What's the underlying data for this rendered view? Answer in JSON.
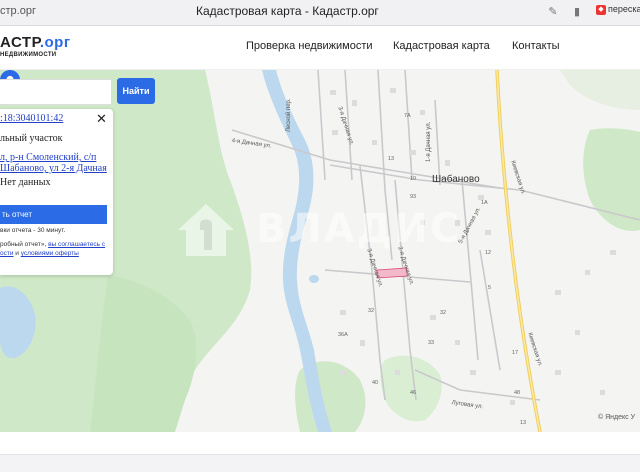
{
  "browser": {
    "url": "стр.орг",
    "title": "Кадастровая карта - Кадастр.орг",
    "tab_chip": "пересказ"
  },
  "site": {
    "logo_main": "АСТР",
    "logo_accent": ".орг",
    "logo_sub": "НЕДВИЖИМОСТИ",
    "nav": [
      "Проверка недвижимости",
      "Кадастровая карта",
      "Контакты"
    ]
  },
  "search": {
    "value": "",
    "button": "Найти"
  },
  "panel": {
    "cadastral_number": ":18:3040101:42",
    "object_type": "льный участок",
    "address": "л, р-н Смоленский, с/п Шабаново, ул 2-я Дачная",
    "value_status": "Нет данных",
    "order_button": "ть отчет",
    "delivery_time": "вки отчета - 30 минут.",
    "agree_prefix": "робный отчет», ",
    "agree_link1": "вы соглашаетесь с",
    "agree_mid": "ости",
    "agree_and": " и ",
    "agree_link2": "условиями оферты"
  },
  "map": {
    "village": "Шабаново",
    "watermark": "ВЛАДИС",
    "copyright": "© Яндекс У",
    "streets": {
      "lesnoy": "Лесной пер.",
      "dachnaya3": "3-я Дачная ул.",
      "dachnaya4": "4-я Дачная ул.",
      "dachnaya1": "1-я Дачная ул.",
      "dachnaya2": "2-я Дачная ул.",
      "dachnaya3b": "3-я Дачная ул.",
      "dachnaya5": "5-я Дачная ул.",
      "kievskaya1": "Киевская ул.",
      "kievskaya2": "Киевская ул.",
      "lugovaya": "Луговая ул."
    },
    "numbers": [
      "7А",
      "13",
      "10",
      "93",
      "1А",
      "12",
      "5",
      "36А",
      "32",
      "33",
      "40",
      "46",
      "48",
      "32",
      "17",
      "13"
    ]
  },
  "colors": {
    "accent": "#2b6be6",
    "forest": "#cfe9c8",
    "water": "#bcd8ef",
    "road_yellow": "#f6d86b"
  }
}
